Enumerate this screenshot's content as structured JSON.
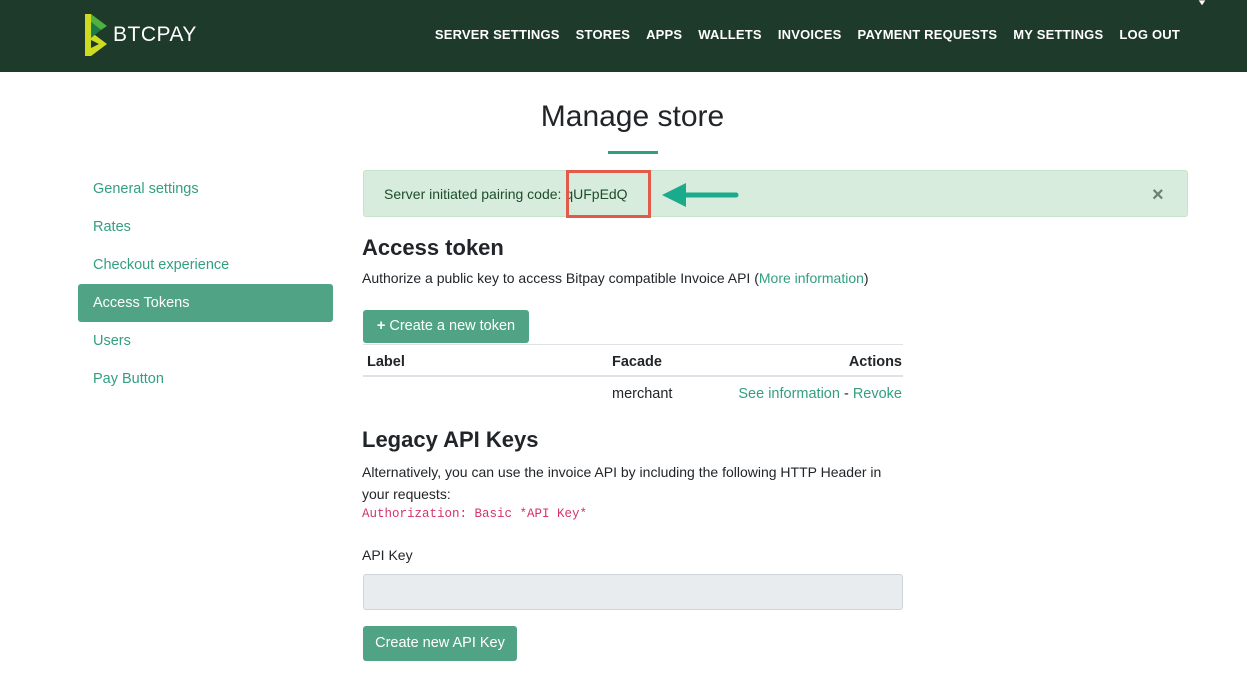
{
  "brand": {
    "name": "BTCPAY"
  },
  "nav": {
    "items": [
      "SERVER SETTINGS",
      "STORES",
      "APPS",
      "WALLETS",
      "INVOICES",
      "PAYMENT REQUESTS",
      "MY SETTINGS",
      "LOG OUT"
    ]
  },
  "page": {
    "title": "Manage store"
  },
  "sidebar": {
    "items": [
      {
        "label": "General settings",
        "active": false
      },
      {
        "label": "Rates",
        "active": false
      },
      {
        "label": "Checkout experience",
        "active": false
      },
      {
        "label": "Access Tokens",
        "active": true
      },
      {
        "label": "Users",
        "active": false
      },
      {
        "label": "Pay Button",
        "active": false
      }
    ]
  },
  "alert": {
    "prefix": "Server initiated pairing code: ",
    "code": "qUFpEdQ",
    "close": "×"
  },
  "access_token": {
    "heading": "Access token",
    "description_prefix": "Authorize a public key to access Bitpay compatible Invoice API (",
    "more_info": "More information",
    "description_suffix": ")",
    "create_button": "Create a new token",
    "columns": {
      "label": "Label",
      "facade": "Facade",
      "actions": "Actions"
    },
    "rows": [
      {
        "label": "",
        "facade": "merchant",
        "see_info": "See information",
        "separator": " - ",
        "revoke": "Revoke"
      }
    ]
  },
  "legacy": {
    "heading": "Legacy API Keys",
    "description": "Alternatively, you can use the invoice API by including the following HTTP Header in your requests:",
    "code": "Authorization: Basic *API Key*",
    "api_key_label": "API Key",
    "api_key_value": "",
    "create_button": "Create new API Key"
  },
  "colors": {
    "navbar": "#1e3a2a",
    "accent": "#51a386",
    "link": "#329f80",
    "alert_bg": "#d7ecdd",
    "annotation_box": "#e15a4a",
    "annotation_arrow": "#1aaa8c"
  }
}
